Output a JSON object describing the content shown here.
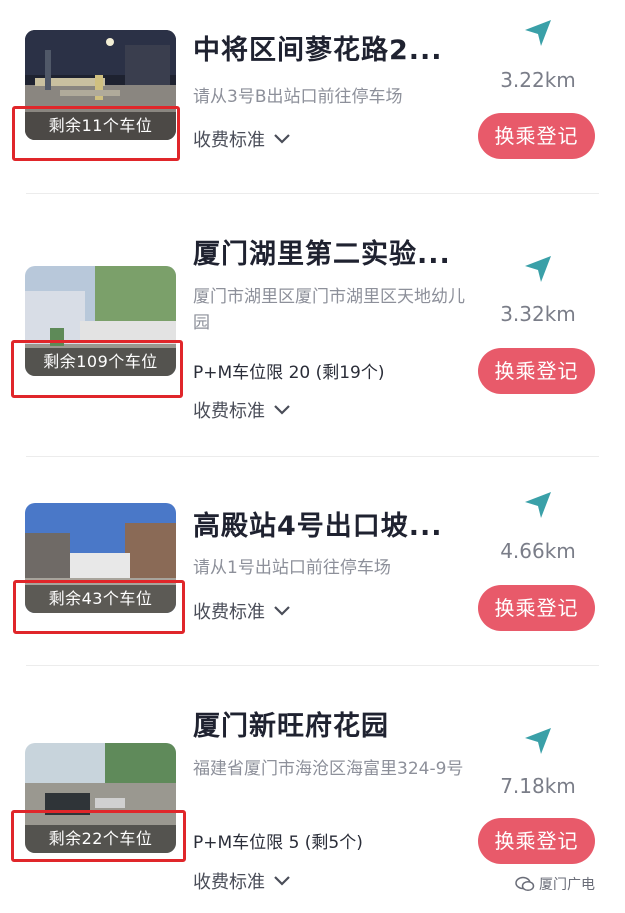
{
  "colors": {
    "accent": "#e85a6a",
    "nav": "#3aa0a8",
    "highlight": "#e0262a"
  },
  "fee_label": "收费标准",
  "action_label": "换乘登记",
  "watermark": "厦门广电",
  "parkings": [
    {
      "title": "中将区间蓼花路2...",
      "address": "请从3号B出站口前往停车场",
      "limit": "",
      "spaces": "剩余11个车位",
      "distance": "3.22km"
    },
    {
      "title": "厦门湖里第二实验...",
      "address": "厦门市湖里区厦门市湖里区天地幼儿园",
      "limit": "P+M车位限 20 (剩19个)",
      "spaces": "剩余109个车位",
      "distance": "3.32km"
    },
    {
      "title": "高殿站4号出口坡...",
      "address": "请从1号出站口前往停车场",
      "limit": "",
      "spaces": "剩余43个车位",
      "distance": "4.66km"
    },
    {
      "title": "厦门新旺府花园",
      "address": "福建省厦门市海沧区海富里324-9号",
      "limit": "P+M车位限 5 (剩5个)",
      "spaces": "剩余22个车位",
      "distance": "7.18km"
    }
  ]
}
